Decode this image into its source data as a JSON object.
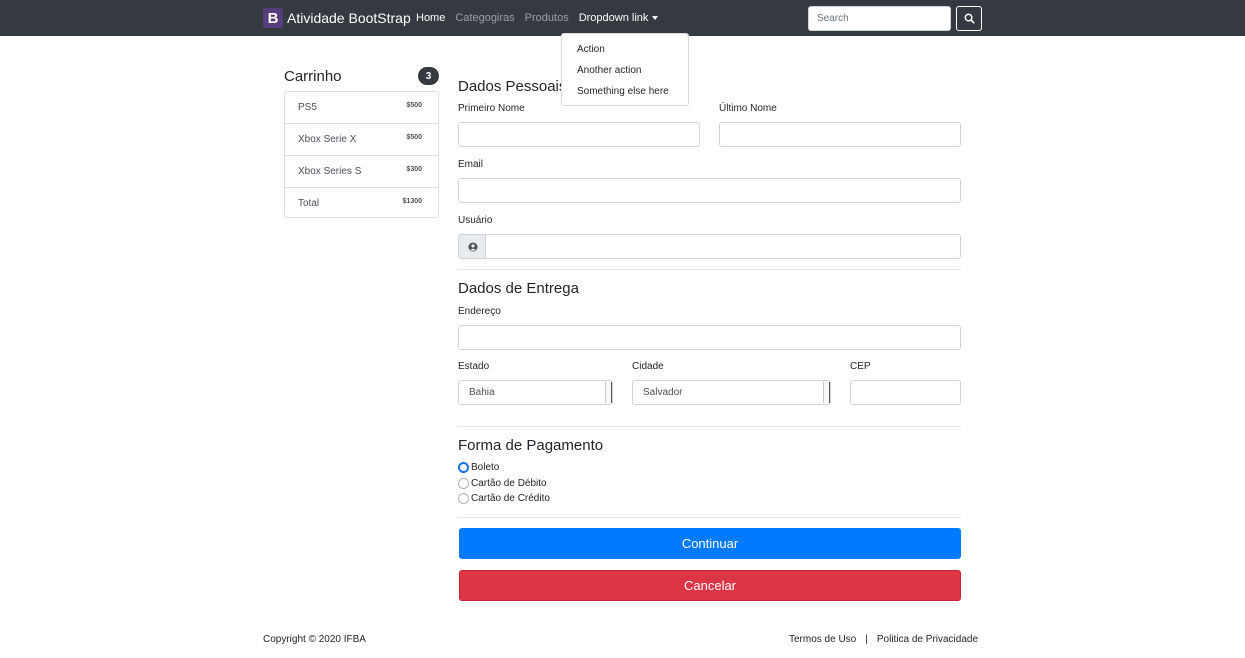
{
  "navbar": {
    "brand_letter": "B",
    "brand_text": "Atividade BootStrap",
    "links": [
      "Home",
      "Categogiras",
      "Produtos"
    ],
    "dropdown_label": "Dropdown link",
    "search_placeholder": "Search",
    "colors": {
      "background": "#343a40",
      "brand": "#563d7c"
    }
  },
  "dropdown": {
    "items": [
      "Action",
      "Another action",
      "Something else here"
    ]
  },
  "cart": {
    "title": "Carrinho",
    "count": "3",
    "items": [
      {
        "name": "PS5",
        "price": "$500"
      },
      {
        "name": "Xbox Serie X",
        "price": "$500"
      },
      {
        "name": "Xbox Series S",
        "price": "$300"
      },
      {
        "name": "Total",
        "price": "$1300"
      }
    ]
  },
  "personal": {
    "title": "Dados Pessoais",
    "first_name_label": "Primeiro Nome",
    "last_name_label": "Último Nome",
    "email_label": "Email",
    "user_label": "Usuário",
    "user_icon": "user-circle-icon"
  },
  "delivery": {
    "title": "Dados de Entrega",
    "address_label": "Endereço",
    "state_label": "Estado",
    "state_value": "Bahia",
    "city_label": "Cidade",
    "city_value": "Salvador",
    "cep_label": "CEP"
  },
  "payment": {
    "title": "Forma de Pagamento",
    "options": [
      "Boleto",
      "Cartão de Débito",
      "Cartão de Crédito"
    ],
    "selected": "Boleto"
  },
  "buttons": {
    "continue": "Continuar",
    "cancel": "Cancelar",
    "colors": {
      "continue": "#007bff",
      "cancel": "#dc3545"
    }
  },
  "footer": {
    "copyright": "Copyright © 2020 IFBA",
    "terms": "Termos de Uso",
    "separator": "|",
    "privacy": "Politica de Privacidade"
  }
}
